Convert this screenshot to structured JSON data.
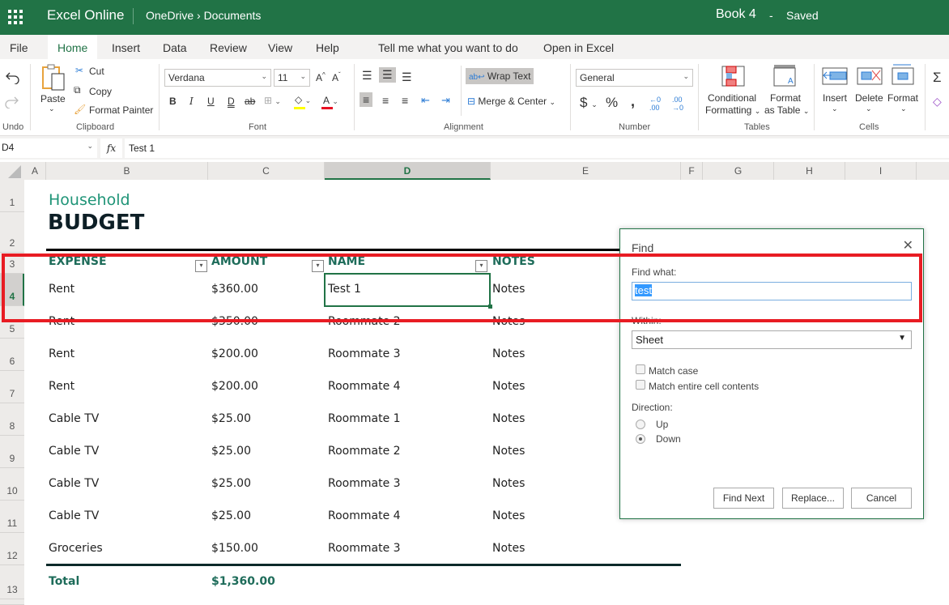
{
  "topbar": {
    "app_name": "Excel Online",
    "breadcrumb": "OneDrive › Documents",
    "doc_title": "Book 4",
    "separator": "-",
    "save_status": "Saved"
  },
  "tabs": [
    {
      "label": "File"
    },
    {
      "label": "Home"
    },
    {
      "label": "Insert"
    },
    {
      "label": "Data"
    },
    {
      "label": "Review"
    },
    {
      "label": "View"
    },
    {
      "label": "Help"
    },
    {
      "label": "Tell me what you want to do"
    },
    {
      "label": "Open in Excel"
    }
  ],
  "ribbon": {
    "undo_group": "Undo",
    "clipboard": {
      "paste": "Paste",
      "cut": "Cut",
      "copy": "Copy",
      "format_painter": "Format Painter",
      "label": "Clipboard"
    },
    "font": {
      "name": "Verdana",
      "size": "11",
      "label": "Font",
      "highlight_color": "#ffff00",
      "font_color": "#e81123"
    },
    "alignment": {
      "wrap_text": "Wrap Text",
      "merge_center": "Merge & Center",
      "label": "Alignment"
    },
    "number": {
      "format": "General",
      "label": "Number"
    },
    "tables": {
      "conditional_1": "Conditional",
      "conditional_2": "Formatting",
      "format_table_1": "Format",
      "format_table_2": "as Table",
      "label": "Tables"
    },
    "cells": {
      "insert": "Insert",
      "delete": "Delete",
      "format": "Format",
      "label": "Cells"
    }
  },
  "formula_bar": {
    "name_box": "D4",
    "fx": "fx",
    "value": "Test 1"
  },
  "columns": [
    "A",
    "B",
    "C",
    "D",
    "E",
    "F",
    "G",
    "H",
    "I"
  ],
  "rows": [
    "1",
    "2",
    "3",
    "4",
    "5",
    "6",
    "7",
    "8",
    "9",
    "10",
    "11",
    "12",
    "13"
  ],
  "sheet": {
    "subtitle": "Household",
    "title": "BUDGET",
    "headers": [
      "EXPENSE",
      "AMOUNT",
      "NAME",
      "NOTES"
    ],
    "data": [
      [
        "Rent",
        "$360.00",
        "Test 1",
        "Notes"
      ],
      [
        "Rent",
        "$350.00",
        "Roommate 2",
        "Notes"
      ],
      [
        "Rent",
        "$200.00",
        "Roommate 3",
        "Notes"
      ],
      [
        "Rent",
        "$200.00",
        "Roommate 4",
        "Notes"
      ],
      [
        "Cable TV",
        "$25.00",
        "Roommate 1",
        "Notes"
      ],
      [
        "Cable TV",
        "$25.00",
        "Roommate 2",
        "Notes"
      ],
      [
        "Cable TV",
        "$25.00",
        "Roommate 3",
        "Notes"
      ],
      [
        "Cable TV",
        "$25.00",
        "Roommate 4",
        "Notes"
      ],
      [
        "Groceries",
        "$150.00",
        "Roommate 3",
        "Notes"
      ]
    ],
    "total_label": "Total",
    "total_value": "$1,360.00"
  },
  "find_dialog": {
    "title": "Find",
    "find_what_label": "Find what:",
    "find_what_value": "test",
    "within_label": "Within:",
    "within_value": "Sheet",
    "match_case": "Match case",
    "match_case_checked": false,
    "match_entire": "Match entire cell contents",
    "match_entire_checked": false,
    "direction_label": "Direction:",
    "up": "Up",
    "down": "Down",
    "direction_selected": "Down",
    "find_next": "Find Next",
    "replace": "Replace...",
    "cancel": "Cancel"
  },
  "colors": {
    "brand": "#217346",
    "header_text": "#1e6c5a",
    "annotation": "#e81c23"
  }
}
